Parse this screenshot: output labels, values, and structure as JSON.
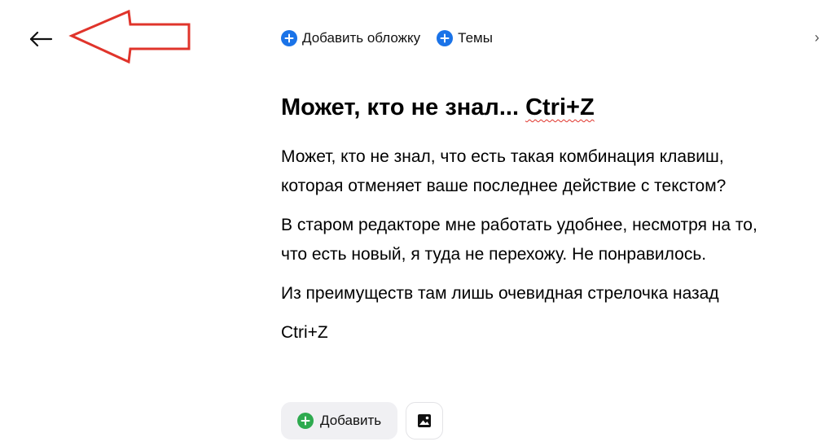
{
  "toolbar": {
    "add_cover_label": "Добавить обложку",
    "themes_label": "Темы"
  },
  "article": {
    "title_text": "Может, кто не знал... ",
    "title_hotkey": "Ctri+Z",
    "paragraphs": [
      "Может, кто не знал, что есть такая комбинация клавиш, которая отменяет ваше последнее действие с текстом?",
      "В старом редакторе мне работать удобнее, несмотря на то, что есть новый, я туда не перехожу. Не понравилось.",
      "Из преимуществ там лишь очевидная стрелочка назад",
      "Ctri+Z"
    ]
  },
  "bottom_bar": {
    "add_label": "Добавить"
  },
  "edge": {
    "cut_off_glyph": "›"
  },
  "icons": {
    "back": "arrow-left-icon",
    "annotation": "red-arrow-annotation",
    "add_cover": "plus-circle-icon",
    "themes": "plus-circle-icon",
    "add": "plus-circle-icon",
    "image": "image-icon"
  },
  "colors": {
    "toolbar_plus": "#1a73e8",
    "add_plus": "#2eaa4f",
    "annotation_arrow": "#e0342b",
    "spellcheck_underline": "#e0342b",
    "add_button_bg": "#f0f0f3"
  }
}
